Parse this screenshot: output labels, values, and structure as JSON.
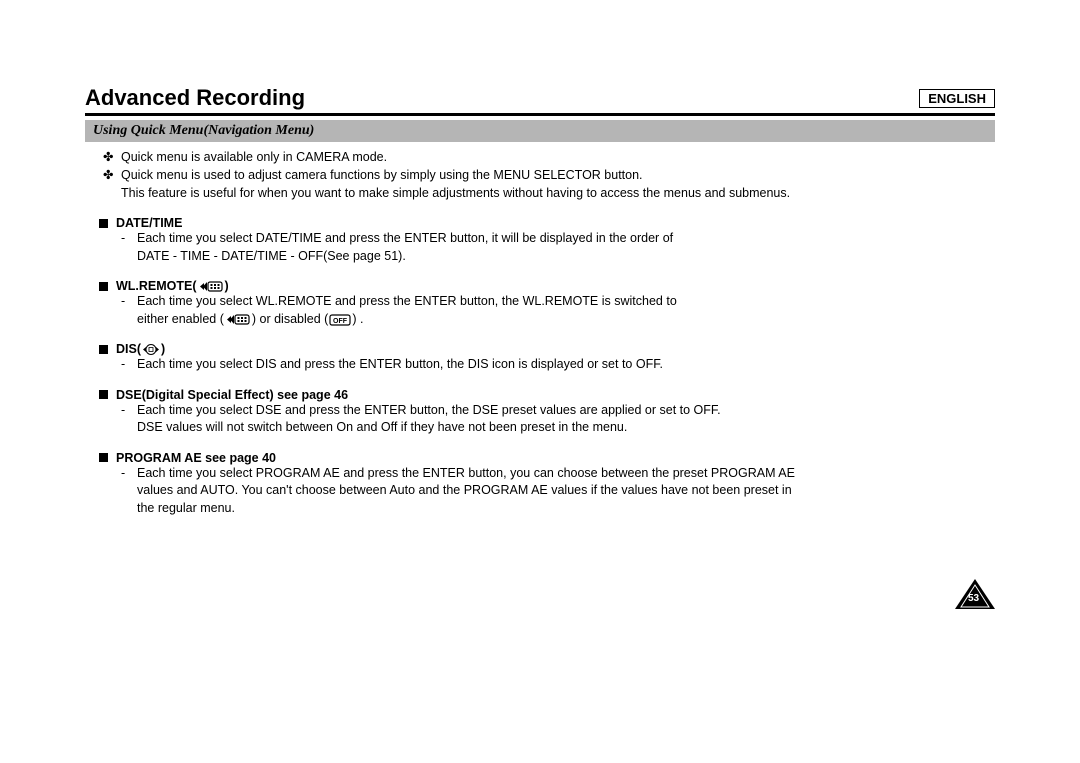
{
  "header": {
    "title": "Advanced Recording",
    "language": "ENGLISH"
  },
  "subheading": "Using Quick Menu(Navigation Menu)",
  "intro": [
    "Quick menu is available only in CAMERA mode.",
    "Quick menu is used to adjust camera functions by simply using the MENU SELECTOR button.",
    "This feature is useful for when you want to make simple adjustments without having to access the menus and submenus."
  ],
  "sections": [
    {
      "title": "DATE/TIME",
      "icon": null,
      "lines": [
        "Each time you select DATE/TIME and press the ENTER button, it will be displayed in the order of",
        "DATE - TIME - DATE/TIME - OFF(See page 51)."
      ]
    },
    {
      "title": "WL.REMOTE(",
      "icon": "remote-icon",
      "title_suffix": ")",
      "lines_html": true,
      "lines": [
        "Each time you select WL.REMOTE and press the ENTER button, the WL.REMOTE is switched to",
        "either enabled ( ICON_REMOTE ) or disabled ( ICON_OFF ) ."
      ]
    },
    {
      "title": "DIS(",
      "icon": "dis-icon",
      "title_suffix": ")",
      "lines": [
        "Each time you select DIS and press the ENTER button, the DIS icon is displayed or set to OFF."
      ]
    },
    {
      "title": "DSE(Digital Special Effect) see page 46",
      "icon": null,
      "lines": [
        "Each time you select DSE and press the ENTER button, the DSE preset values are applied or set to OFF.",
        "DSE values will not switch between On and Off if they have not been preset in the menu."
      ]
    },
    {
      "title": "PROGRAM AE see page 40",
      "icon": null,
      "lines": [
        "Each time you select PROGRAM AE and press the ENTER button, you can choose between the preset PROGRAM AE",
        "values and AUTO. You can't choose between Auto and the PROGRAM AE values if the values have not been preset in",
        "the regular menu."
      ]
    }
  ],
  "page_number": "53"
}
